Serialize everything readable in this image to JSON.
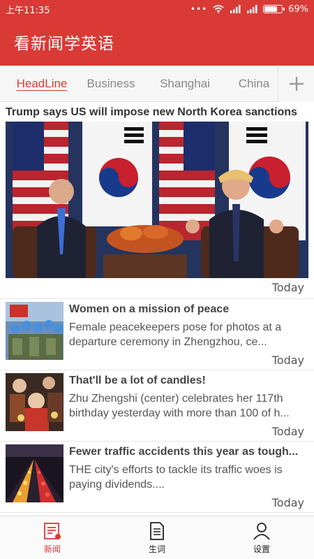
{
  "status_bar": {
    "time": "上午11:35",
    "dots": "•••",
    "battery": "69%",
    "battery_level": 0.69
  },
  "app_bar": {
    "title": "看新闻学英语"
  },
  "tabs": [
    {
      "label": "HeadLine",
      "active": true
    },
    {
      "label": "Business",
      "active": false
    },
    {
      "label": "Shanghai",
      "active": false
    },
    {
      "label": "China",
      "active": false
    }
  ],
  "headline": {
    "title": "Trump says US will impose new North Korea sanctions",
    "date": "Today"
  },
  "news_list": [
    {
      "title": "Women on a mission of peace",
      "summary": "Female peacekeepers pose for photos at a departure ceremony in Zhengzhou, ce...",
      "date": "Today"
    },
    {
      "title": "That'll be a lot of candles!",
      "summary": "Zhu Zhengshi (center) celebrates her 117th birthday yesterday with more than 100 of h...",
      "date": "Today"
    },
    {
      "title": "Fewer traffic accidents this year as tough...",
      "summary": "THE city's efforts to tackle its traffic woes is paying dividends....",
      "date": "Today"
    }
  ],
  "bottom_nav": [
    {
      "label": "新闻",
      "icon": "news-icon",
      "active": true
    },
    {
      "label": "生词",
      "icon": "vocabulary-icon",
      "active": false
    },
    {
      "label": "设置",
      "icon": "user-settings-icon",
      "active": false
    }
  ],
  "colors": {
    "brand_red": "#d93a36",
    "tab_inactive": "#888888"
  }
}
